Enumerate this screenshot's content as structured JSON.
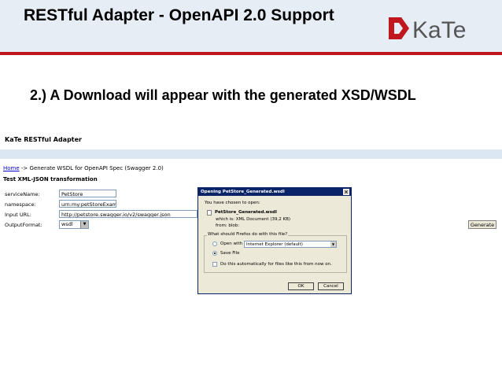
{
  "slide": {
    "title": "RESTful Adapter  - OpenAPI 2.0 Support",
    "subtitle": "2.) A Download will appear with the generated XSD/WSDL",
    "logo_text": "KaTe",
    "accent_color": "#c0161d"
  },
  "app": {
    "title": "KaTe RESTful Adapter",
    "breadcrumb": {
      "home": "Home",
      "rest": " -> Generate WSDL for OpenAPI Spec (Swagger 2.0)"
    },
    "section_title": "Test XML-JSON transformation",
    "form": {
      "service_name": {
        "label": "serviceName:",
        "value": "PetStore"
      },
      "namespace": {
        "label": "namespace:",
        "value": "urn:my:petStoreExample"
      },
      "input_url": {
        "label": "Input URL:",
        "value": "http://petstore.swagger.io/v2/swagger.json"
      },
      "output_format": {
        "label": "OutputFormat:",
        "value": "wsdl"
      }
    },
    "generate_label": "Generate"
  },
  "dialog": {
    "title": "Opening PetStore_Generated.wsdl",
    "intro": "You have chosen to open:",
    "file_name": "PetStore_Generated.wsdl",
    "which_is": "which is: XML Document (39,2 KB)",
    "from": "from: blob:",
    "question": "What should Firefox do with this file?",
    "open_with_label": "Open with",
    "open_with_app": "Internet Explorer (default)",
    "save_file_label": "Save File",
    "auto_label": "Do this automatically for files like this from now on.",
    "ok_label": "OK",
    "cancel_label": "Cancel"
  }
}
